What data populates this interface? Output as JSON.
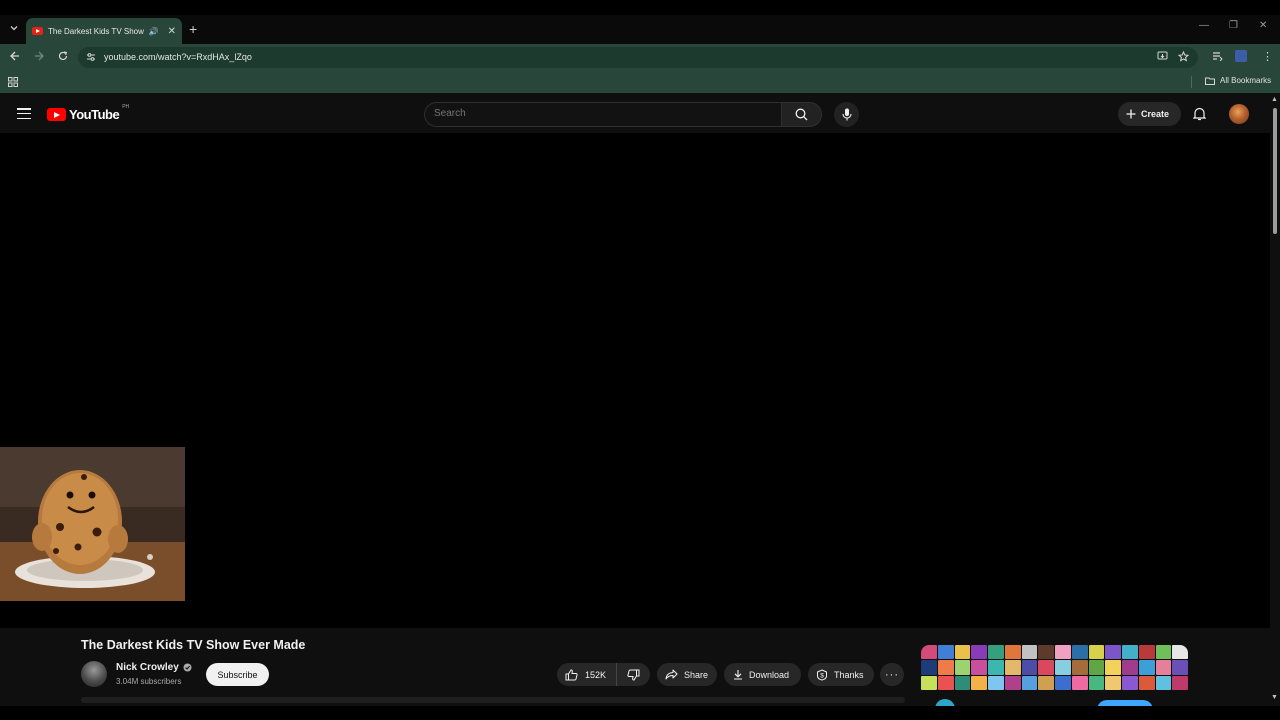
{
  "browser": {
    "tab_title": "The Darkest Kids TV Show E",
    "url": "youtube.com/watch?v=RxdHAx_lZqo",
    "bookmarks_label": "All Bookmarks",
    "new_tab_glyph": "+",
    "close_tab_glyph": "✕",
    "speaker_glyph": "🔊"
  },
  "youtube": {
    "logo_text": "YouTube",
    "region_code": "PH",
    "search_placeholder": "Search",
    "create_label": "Create"
  },
  "video": {
    "title": "The Darkest Kids TV Show Ever Made",
    "channel_name": "Nick Crowley",
    "subscribers": "3.04M subscribers",
    "subscribe_label": "Subscribe",
    "like_count": "152K",
    "share_label": "Share",
    "download_label": "Download",
    "thanks_label": "Thanks",
    "more_glyph": "···"
  },
  "icons": {
    "tab_search": "chevron-down-icon",
    "back": "arrow-left-icon",
    "forward": "arrow-right-icon",
    "reload": "reload-icon",
    "site_info": "tune-icon",
    "install": "install-icon",
    "bookmark_star": "star-icon",
    "apps": "grid-icon",
    "verified": "verified-badge-icon",
    "bell": "bell-icon"
  },
  "colors": {
    "chrome_theme": "#28473a",
    "youtube_red": "#ff0000",
    "page_bg": "#0f0f0f",
    "button_bg": "#272727",
    "subscribe_bg": "#f1f1f1"
  },
  "ad_tile_colors": [
    "#d24b7a",
    "#3f7fd6",
    "#e8c14a",
    "#8a3cb8",
    "#35a07d",
    "#e0773a",
    "#c2c2c2",
    "#5d3a2a",
    "#f0a0c0",
    "#2a6fa8",
    "#d6d04c",
    "#7c55c9",
    "#42b0c8",
    "#b83a3a",
    "#6fbf5a",
    "#e6e6e6",
    "#1f3c7a",
    "#f07a48",
    "#9bd36e",
    "#c94f9d",
    "#3bb7b0",
    "#e2b96b",
    "#4d4da8",
    "#d9485e",
    "#88cde0",
    "#a56b3a",
    "#5fa646",
    "#f2d25a",
    "#a03c8c",
    "#3e9ed8",
    "#e67f9a",
    "#6a4fb6",
    "#c6e05a",
    "#e85252",
    "#2f8c7a",
    "#f4b04a",
    "#7ec6f0",
    "#b0408a",
    "#56a0e0",
    "#d0a050",
    "#3c6ed0",
    "#ee6aa0",
    "#48b880",
    "#f0c870",
    "#8a58d0",
    "#da5a3a",
    "#60c0e0",
    "#bd3a6a"
  ]
}
